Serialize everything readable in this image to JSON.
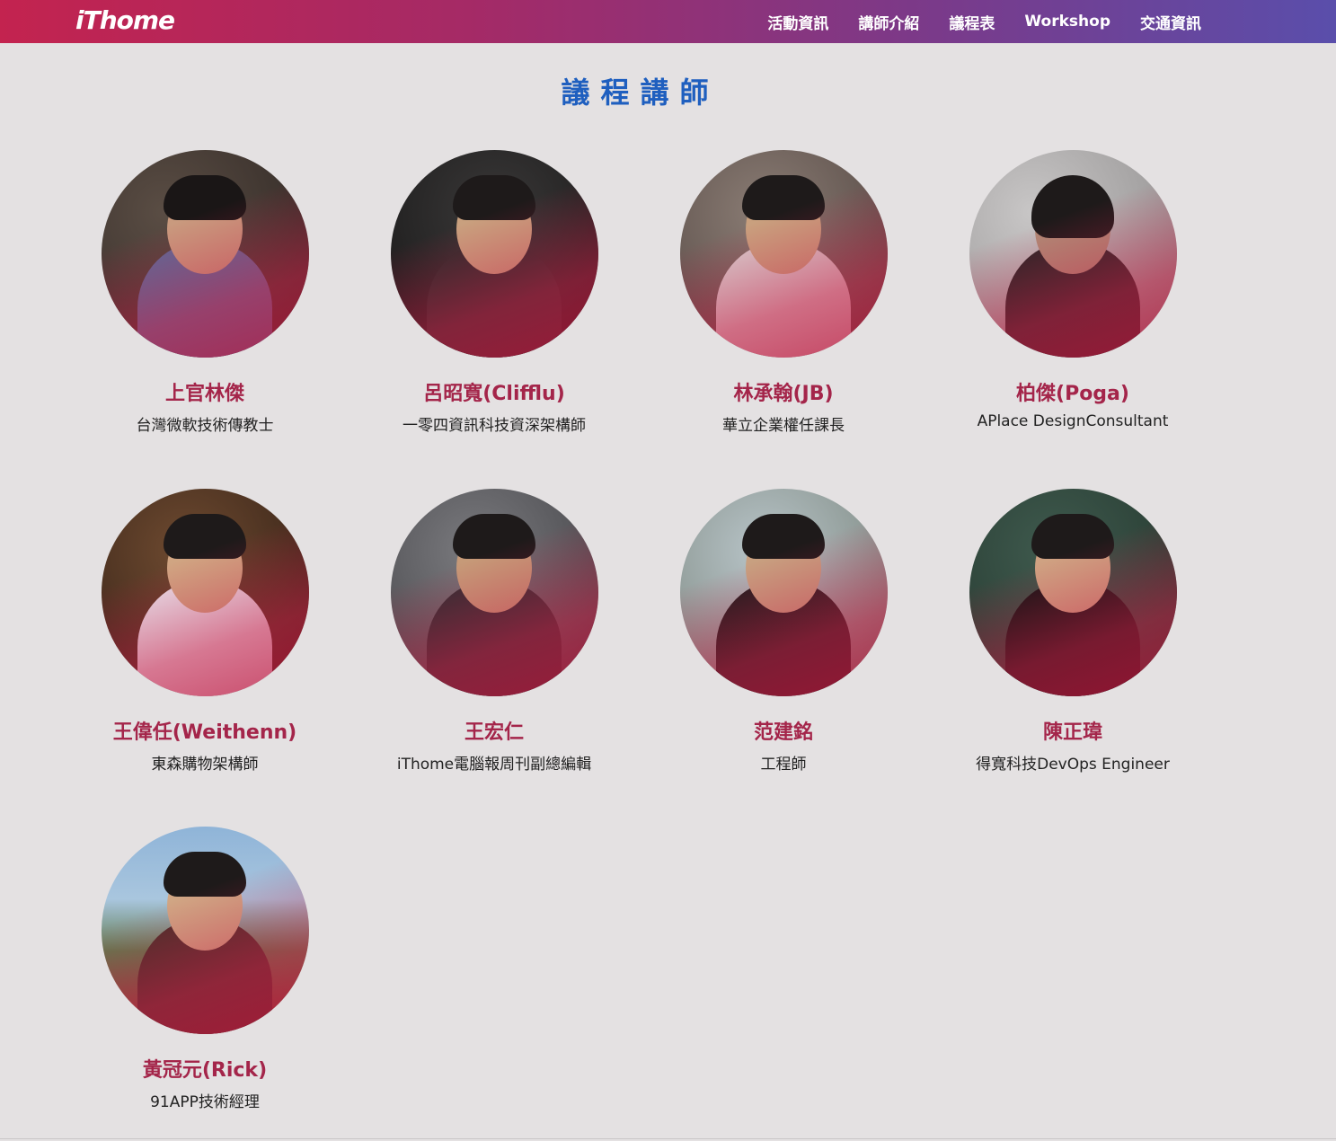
{
  "header": {
    "logo": "iThome",
    "nav": [
      "活動資訊",
      "講師介紹",
      "議程表",
      "Workshop",
      "交通資訊"
    ]
  },
  "page_title": "議程講師",
  "speakers": [
    {
      "name": "上官林傑",
      "role": "台灣微軟技術傳教士"
    },
    {
      "name": "呂昭寬(Clifflu)",
      "role": "一零四資訊科技資深架構師"
    },
    {
      "name": "林承翰(JB)",
      "role": "華立企業權任課長"
    },
    {
      "name": "柏傑(Poga)",
      "role": "APlace DesignConsultant"
    },
    {
      "name": "王偉任(Weithenn)",
      "role": "東森購物架構師"
    },
    {
      "name": "王宏仁",
      "role": "iThome電腦報周刊副總編輯"
    },
    {
      "name": "范建銘",
      "role": "工程師"
    },
    {
      "name": "陳正瑋",
      "role": "得寬科技DevOps Engineer"
    },
    {
      "name": "黃冠元(Rick)",
      "role": "91APP技術經理"
    }
  ],
  "colors": {
    "accent_title": "#1f5fbf",
    "speaker_name": "#a4254a",
    "header_gradient_start": "#c3234f",
    "header_gradient_end": "#5a4eab"
  }
}
